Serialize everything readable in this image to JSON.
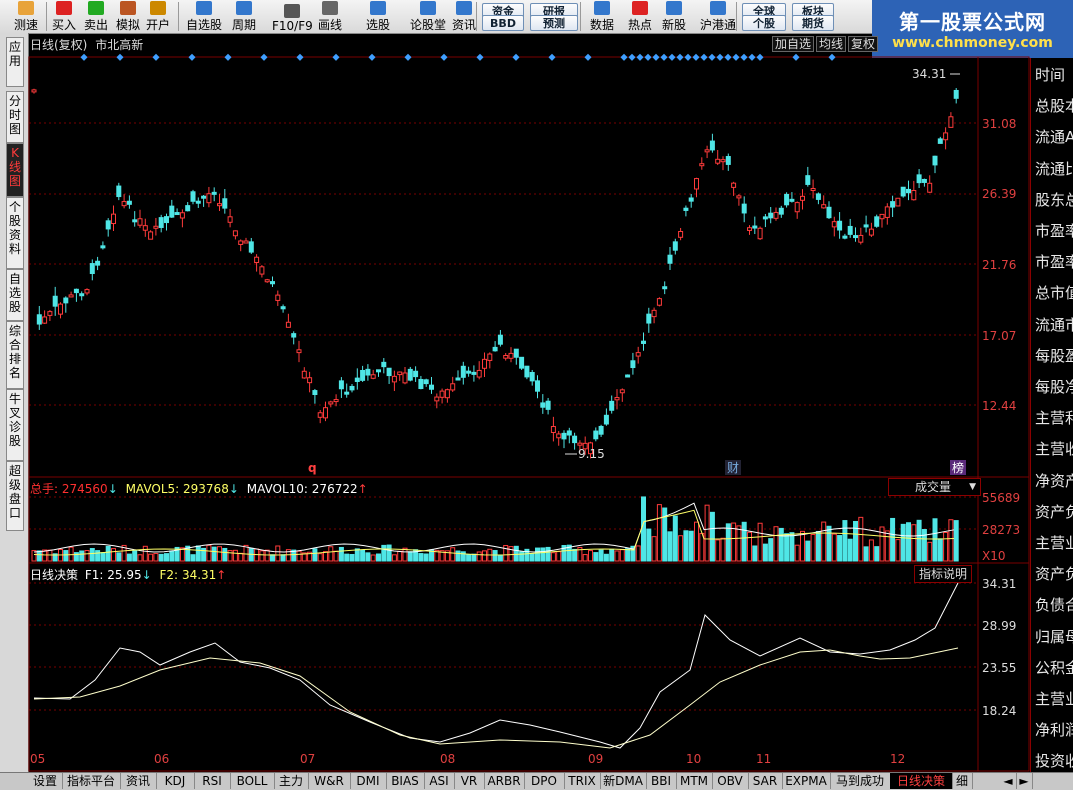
{
  "toolbar": {
    "items": [
      {
        "label": "测速",
        "icon": "clock-icon"
      },
      {
        "label": "买入",
        "icon": "buy-icon"
      },
      {
        "label": "卖出",
        "icon": "sell-icon"
      },
      {
        "label": "模拟",
        "icon": "simulate-icon"
      },
      {
        "label": "开户",
        "icon": "open-account-icon"
      },
      {
        "label": "自选股",
        "icon": "star-icon"
      },
      {
        "label": "周期",
        "icon": "clock-icon"
      },
      {
        "label": "F10/F9",
        "icon": "f10-icon"
      },
      {
        "label": "画线",
        "icon": "draw-icon"
      },
      {
        "label": "选股",
        "icon": "select-stock-icon"
      },
      {
        "label": "论股堂",
        "icon": "forum-icon"
      },
      {
        "label": "资讯",
        "icon": "news-icon"
      },
      {
        "label": "数据",
        "icon": "pe-icon"
      },
      {
        "label": "热点",
        "icon": "hot-icon"
      },
      {
        "label": "新股",
        "icon": "new-stock-icon"
      },
      {
        "label": "沪港通",
        "icon": "hk-icon"
      }
    ],
    "pills": [
      "资金",
      "BBD",
      "研报",
      "预测",
      "全球",
      "个股",
      "板块",
      "期货"
    ]
  },
  "watermark": {
    "title": "第一股票公式网",
    "url": "www.chnmoney.com"
  },
  "left_tabs": [
    "应用",
    "分时图",
    "K线图",
    "个股资料",
    "自选股",
    "综合排名",
    "牛叉诊股",
    "超级盘口"
  ],
  "chart": {
    "title": "日线(复权)",
    "stock": "市北高新",
    "top_buttons": [
      "加自选",
      "均线",
      "复权"
    ],
    "price_axis": [
      "34.31",
      "31.08",
      "26.39",
      "21.76",
      "17.07",
      "12.44"
    ],
    "high_label": "34.31",
    "low_label": "9.15",
    "markers": {
      "q": "q",
      "cai": "财",
      "bang": "榜"
    }
  },
  "volume": {
    "label_total": "总手:",
    "total": "274560",
    "ma5_label": "MAVOL5:",
    "ma5": "293768",
    "ma10_label": "MAVOL10:",
    "ma10": "276722",
    "dropdown": "成交量",
    "axis": [
      "55689",
      "28273",
      "X10"
    ]
  },
  "indicator": {
    "name": "日线决策",
    "f1_label": "F1:",
    "f1": "25.95",
    "f2_label": "F2:",
    "f2": "34.31",
    "help": "指标说明",
    "axis": [
      "34.31",
      "28.99",
      "23.55",
      "18.24"
    ]
  },
  "x_axis": [
    "05",
    "06",
    "07",
    "08",
    "09",
    "10",
    "11",
    "12"
  ],
  "right_panel": [
    "时间",
    "总股本",
    "流通A",
    "流通比",
    "股东总",
    "市盈率",
    "市盈率",
    "总市值",
    "流通市",
    "每股盈",
    "每股净",
    "主营利",
    "主营收",
    "净资产",
    "资产负",
    "主营业",
    "资产负",
    "负债合",
    "归属母",
    "公积金",
    "主营业",
    "净利润",
    "投资收"
  ],
  "bottom_tabs": [
    "设置",
    "指标平台",
    "资讯",
    "KDJ",
    "RSI",
    "BOLL",
    "主力",
    "W&R",
    "DMI",
    "BIAS",
    "ASI",
    "VR",
    "ARBR",
    "DPO",
    "TRIX",
    "新DMA",
    "BBI",
    "MTM",
    "OBV",
    "SAR",
    "EXPMA",
    "马到成功",
    "日线决策",
    "细"
  ],
  "colors": {
    "up": "#ff3b3b",
    "down": "#4fe6e6",
    "grid": "#7a0000",
    "ma5": "#ffffff",
    "ma10": "#ffff66",
    "accent": "#2d63b6"
  }
}
